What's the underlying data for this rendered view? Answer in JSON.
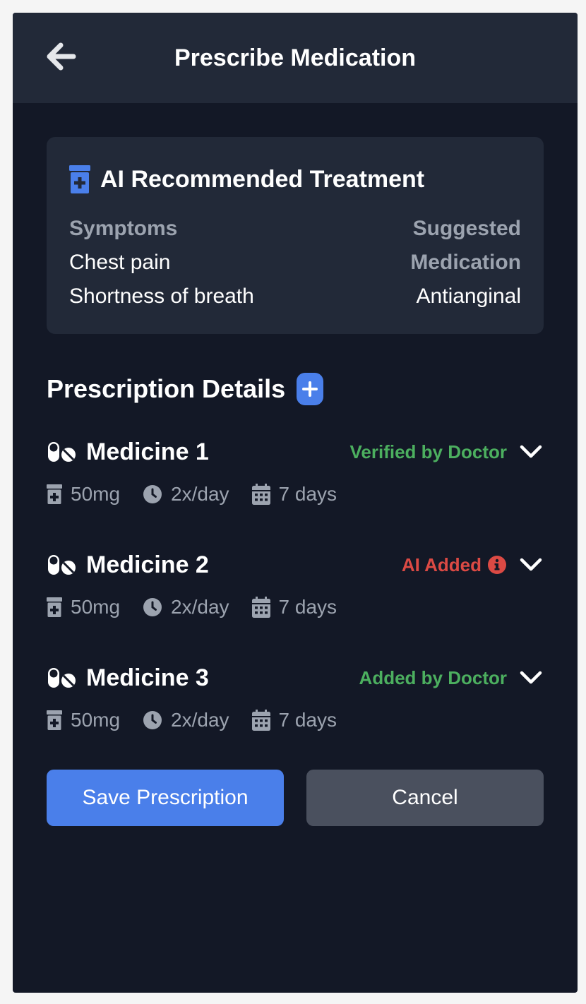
{
  "header": {
    "title": "Prescribe Medication",
    "back_icon": "arrow-left-icon"
  },
  "ai_card": {
    "title": "AI Recommended Treatment",
    "icon": "prescription-bottle-icon",
    "accent_color": "#4a7fea",
    "symptoms_label": "Symptoms",
    "symptoms": [
      "Chest pain",
      "Shortness of breath"
    ],
    "suggested_label_line1": "Suggested",
    "suggested_label_line2": "Medication",
    "suggested_value": "Antianginal"
  },
  "prescription": {
    "title": "Prescription Details",
    "add_icon": "plus-icon",
    "medicines": [
      {
        "name": "Medicine 1",
        "status": "Verified by Doctor",
        "status_color": "#4caf5f",
        "dose": "50mg",
        "frequency": "2x/day",
        "duration": "7 days"
      },
      {
        "name": "Medicine 2",
        "status": "AI Added",
        "status_color": "#dc4a44",
        "status_icon": "info-circle-icon",
        "dose": "50mg",
        "frequency": "2x/day",
        "duration": "7 days"
      },
      {
        "name": "Medicine 3",
        "status": "Added by Doctor",
        "status_color": "#4caf5f",
        "dose": "50mg",
        "frequency": "2x/day",
        "duration": "7 days"
      }
    ]
  },
  "actions": {
    "save_label": "Save Prescription",
    "cancel_label": "Cancel",
    "save_color": "#4a7fea",
    "cancel_color": "#4a505e"
  }
}
